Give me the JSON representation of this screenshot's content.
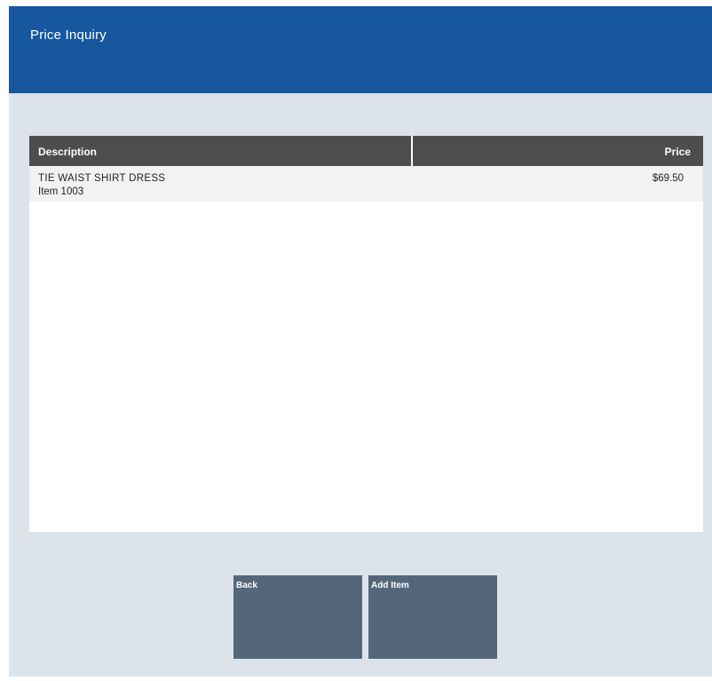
{
  "window": {
    "title": "Price Inquiry"
  },
  "table": {
    "columns": {
      "description": "Description",
      "price": "Price"
    },
    "rows": [
      {
        "description": "TIE WAIST SHIRT DRESS",
        "item": "Item 1003",
        "price": "$69.50"
      }
    ]
  },
  "buttons": {
    "back": "Back",
    "add_item": "Add Item"
  },
  "colors": {
    "title_bar": "#16579f",
    "background": "#dde3ea",
    "table_header": "#4d4d4d",
    "button": "#54677a"
  }
}
